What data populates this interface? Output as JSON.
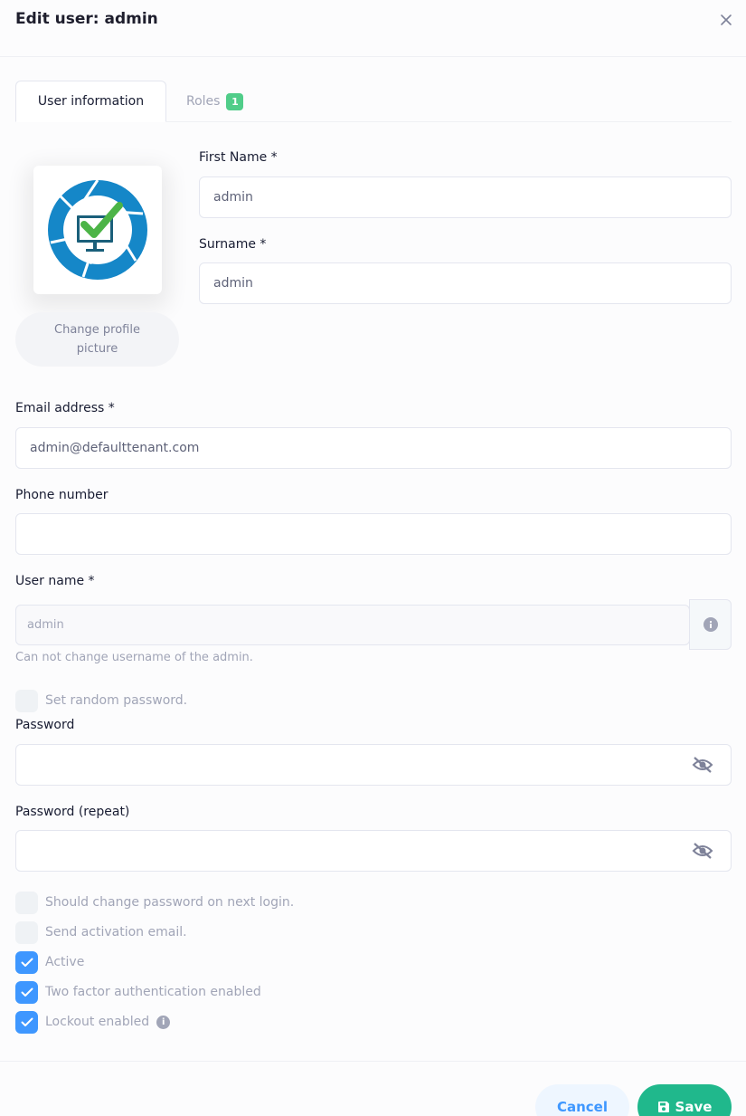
{
  "modal": {
    "title": "Edit user: admin"
  },
  "tabs": [
    {
      "label": "User information",
      "active": true
    },
    {
      "label": "Roles",
      "badge": "1",
      "active": false
    }
  ],
  "profile": {
    "change_picture_label": "Change profile picture"
  },
  "fields": {
    "first_name": {
      "label": "First Name *",
      "value": "admin"
    },
    "surname": {
      "label": "Surname *",
      "value": "admin"
    },
    "email": {
      "label": "Email address *",
      "value": "admin@defaulttenant.com"
    },
    "phone": {
      "label": "Phone number",
      "value": ""
    },
    "username": {
      "label": "User name *",
      "value": "admin",
      "help": "Can not change username of the admin."
    },
    "password": {
      "label": "Password",
      "value": ""
    },
    "password_repeat": {
      "label": "Password (repeat)",
      "value": ""
    }
  },
  "checkboxes": {
    "random_password": {
      "label": "Set random password.",
      "checked": false
    },
    "change_password_next_login": {
      "label": "Should change password on next login.",
      "checked": false
    },
    "send_activation_email": {
      "label": "Send activation email.",
      "checked": false
    },
    "active": {
      "label": "Active",
      "checked": true
    },
    "two_factor": {
      "label": "Two factor authentication enabled",
      "checked": true
    },
    "lockout": {
      "label": "Lockout enabled",
      "checked": true
    }
  },
  "footer": {
    "cancel_label": "Cancel",
    "save_label": "Save"
  },
  "colors": {
    "primary": "#3e97ff",
    "success": "#20b88c",
    "badge": "#50cd89"
  }
}
